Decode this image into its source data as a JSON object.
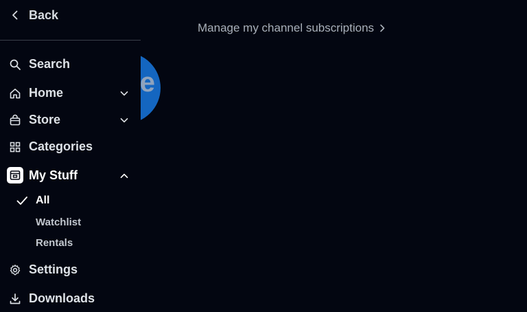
{
  "background": {
    "partial_link": "ptions",
    "manage_link": "Manage my channel subscriptions",
    "badge_letter": "e",
    "badge_color": "#1466c0"
  },
  "nav": {
    "back_label": "Back",
    "items": [
      {
        "label": "Search",
        "icon": "search-icon"
      },
      {
        "label": "Home",
        "icon": "home-icon",
        "caret": "chevron-down-icon"
      },
      {
        "label": "Store",
        "icon": "store-bag-icon",
        "caret": "chevron-down-icon"
      },
      {
        "label": "Categories",
        "icon": "grid-icon"
      },
      {
        "label": "My Stuff",
        "icon": "my-stuff-icon",
        "caret": "chevron-up-icon",
        "expanded": true
      }
    ],
    "my_stuff_subitems": [
      {
        "label": "All",
        "selected": true
      },
      {
        "label": "Watchlist",
        "selected": false
      },
      {
        "label": "Rentals",
        "selected": false
      }
    ],
    "footer_items": [
      {
        "label": "Settings",
        "icon": "gear-icon"
      },
      {
        "label": "Downloads",
        "icon": "download-icon"
      }
    ]
  },
  "colors": {
    "background": "#030611",
    "text": "#dde1e6",
    "muted_text": "#a9b0b9",
    "divider": "#3a3f49"
  }
}
